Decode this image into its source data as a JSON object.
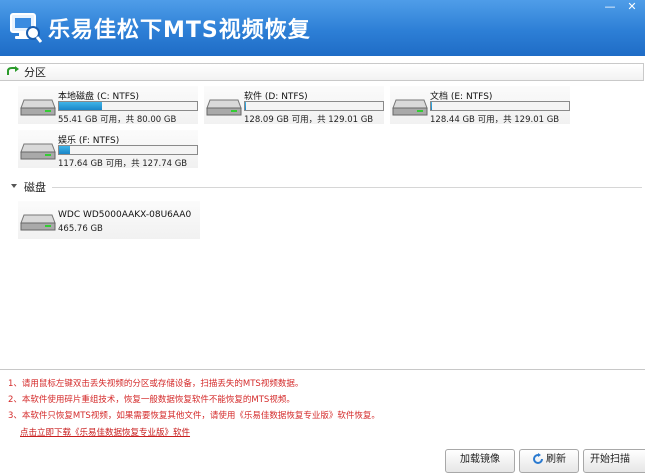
{
  "app": {
    "title": "乐易佳松下MTS视频恢复"
  },
  "window": {
    "minimize": "—",
    "close": "✕"
  },
  "partitions": {
    "section_label": "分区",
    "items": [
      {
        "name": "本地磁盘 (C: NTFS)",
        "info": "55.41 GB 可用，共 80.00 GB",
        "used_fraction": 0.31
      },
      {
        "name": "软件 (D: NTFS)",
        "info": "128.09 GB 可用，共 129.01 GB",
        "used_fraction": 0.01
      },
      {
        "name": "文档 (E: NTFS)",
        "info": "128.44 GB 可用，共 129.01 GB",
        "used_fraction": 0.005
      },
      {
        "name": "娱乐 (F: NTFS)",
        "info": "117.64 GB 可用，共 127.74 GB",
        "used_fraction": 0.08
      }
    ]
  },
  "disks": {
    "section_label": "磁盘",
    "items": [
      {
        "name": "WDC WD5000AAKX-08U6AA0",
        "info": "465.76 GB"
      }
    ]
  },
  "notes": [
    "1、请用鼠标左键双击丢失视频的分区或存储设备，扫描丢失的MTS视频数据。",
    "2、本软件使用碎片重组技术，恢复一般数据恢复软件不能恢复的MTS视频。",
    "3、本软件只恢复MTS视频，如果需要恢复其他文件，请使用《乐易佳数据恢复专业版》软件恢复。"
  ],
  "download_link": "点击立即下载《乐易佳数据恢复专业版》软件",
  "buttons": {
    "load": "加载镜像",
    "refresh": "刷新",
    "start_scan": "开始扫描"
  },
  "colors": {
    "accent": "#2d7fd6",
    "notes": "#d42a2a",
    "bar_fill": "#1a86c8"
  }
}
